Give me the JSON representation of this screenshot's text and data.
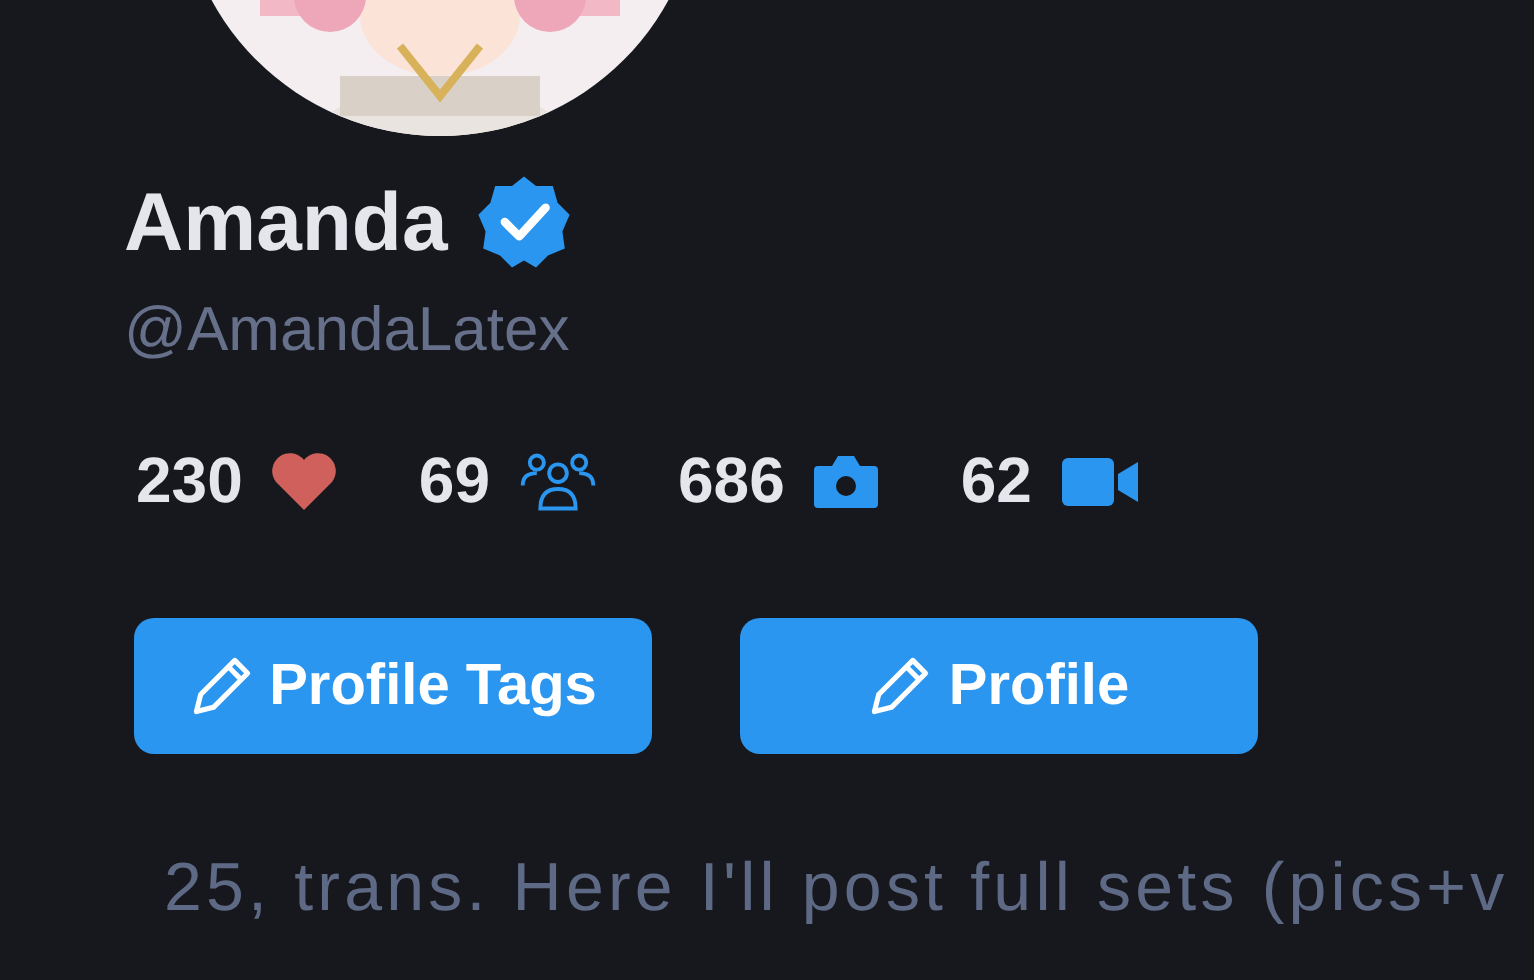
{
  "profile": {
    "name": "Amanda",
    "verified": true,
    "handle": "@AmandaLatex"
  },
  "stats": [
    {
      "value": "230",
      "kind": "likes"
    },
    {
      "value": "69",
      "kind": "followers"
    },
    {
      "value": "686",
      "kind": "photos"
    },
    {
      "value": "62",
      "kind": "videos"
    }
  ],
  "buttons": [
    {
      "label": "Profile Tags"
    },
    {
      "label": "Profile"
    }
  ],
  "bio": "25, trans. Here I'll post full sets (pics+v"
}
